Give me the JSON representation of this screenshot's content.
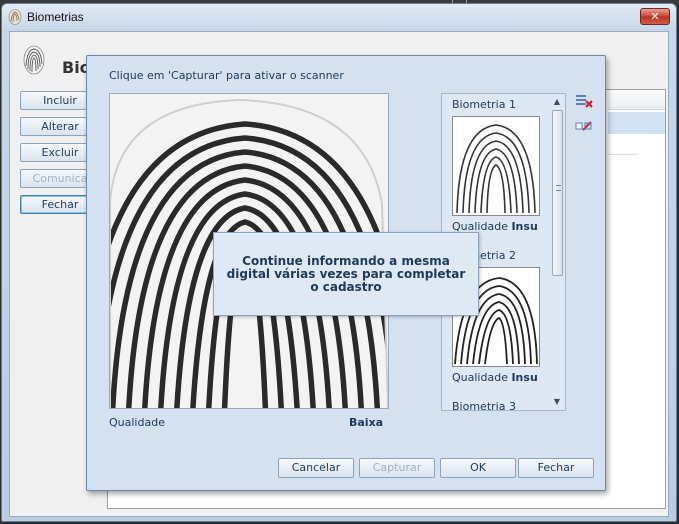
{
  "window": {
    "title": "Biometrias",
    "heading": "Bio"
  },
  "side_buttons": [
    "Incluir",
    "Alterar",
    "Excluir",
    "Comunica",
    "Fechar"
  ],
  "dialog": {
    "instruction": "Clique em 'Capturar' para ativar o scanner",
    "quality_label": "Qualidade",
    "quality_value": "Baixa",
    "message": "Continue informando a mesma digital várias vezes para completar o cadastro",
    "buttons": {
      "cancel": "Cancelar",
      "capture": "Capturar",
      "ok": "OK",
      "close": "Fechar"
    }
  },
  "thumbnails": [
    {
      "title": "Biometria 1",
      "quality_label": "Qualidade",
      "quality_value": "Insu"
    },
    {
      "title": "Biometria 2",
      "quality_label": "Qualidade",
      "quality_value": "Insu"
    },
    {
      "title": "Biometria 3"
    }
  ],
  "icons": {
    "app": "fingerprint-icon",
    "close": "close-icon",
    "remove_list": "delete-list-icon",
    "remove_item": "remove-item-icon"
  },
  "colors": {
    "close_button": "#c8432f",
    "dialog_bg": "#d3e1f1",
    "text": "#1e395b"
  }
}
